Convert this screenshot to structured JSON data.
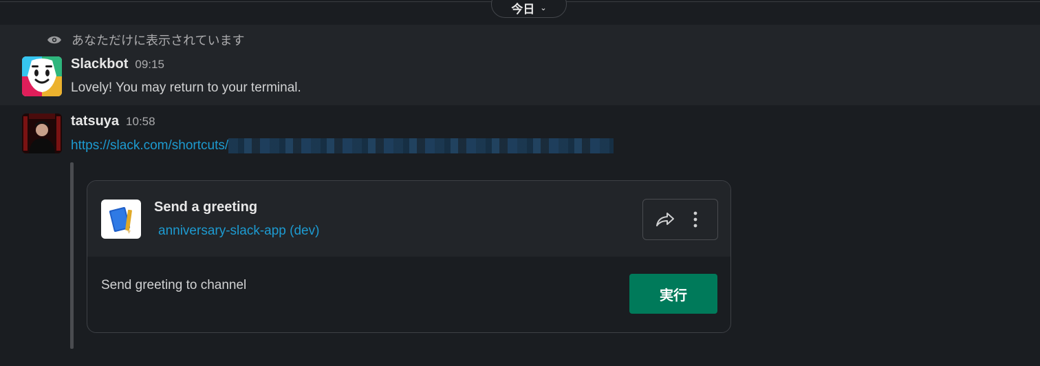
{
  "date_divider": {
    "label": "今日"
  },
  "ephemeral": {
    "notice": "あなただけに表示されています",
    "sender": "Slackbot",
    "time": "09:15",
    "text": "Lovely! You may return to your terminal."
  },
  "message": {
    "sender": "tatsuya",
    "time": "10:58",
    "link_text": "https://slack.com/shortcuts/"
  },
  "card": {
    "title": "Send a greeting",
    "app_name": "anniversary-slack-app (dev)",
    "description": "Send greeting to channel",
    "run_label": "実行",
    "icons": [
      "share-icon",
      "more-vertical-icon",
      "notebook-icon"
    ]
  },
  "colors": {
    "background": "#1a1d21",
    "highlight": "#222529",
    "link": "#1d9bd1",
    "button": "#007a5a"
  }
}
